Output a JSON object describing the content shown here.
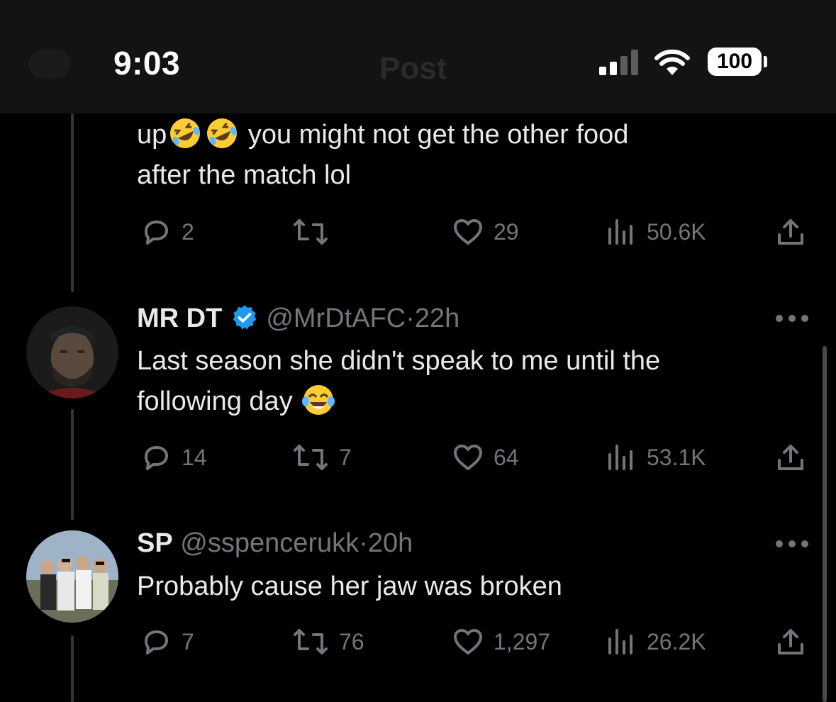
{
  "status_bar": {
    "time": "9:03",
    "battery": "100",
    "ghost_title": "Post"
  },
  "tweets": [
    {
      "text_line1_a": "up",
      "text_line1_b": "you might not get the other food",
      "text_line2": "after the match lol",
      "emoji": [
        "rolling-on-floor-laughing",
        "rolling-on-floor-laughing"
      ],
      "replies": "2",
      "retweets": "",
      "likes": "29",
      "views": "50.6K"
    },
    {
      "name": "MR DT",
      "verified": true,
      "handle": "@MrDtAFC",
      "dot": "·",
      "time": "22h",
      "text_line1": "Last season she didn't speak to me until the",
      "text_line2": "following day",
      "emoji": [
        "face-with-tears-of-joy"
      ],
      "replies": "14",
      "retweets": "7",
      "likes": "64",
      "views": "53.1K"
    },
    {
      "name": "SP",
      "handle": "@sspencerukk",
      "dot": "·",
      "time": "20h",
      "text_line1": "Probably cause her jaw was broken",
      "replies": "7",
      "retweets": "76",
      "likes": "1,297",
      "views": "26.2K"
    }
  ],
  "colors": {
    "background": "#000000",
    "text": "#e7e9ea",
    "muted": "#71767b",
    "verified": "#1d9bf0"
  },
  "icons": [
    "reply-icon",
    "retweet-icon",
    "like-icon",
    "views-icon",
    "share-icon",
    "more-icon",
    "verified-icon"
  ]
}
